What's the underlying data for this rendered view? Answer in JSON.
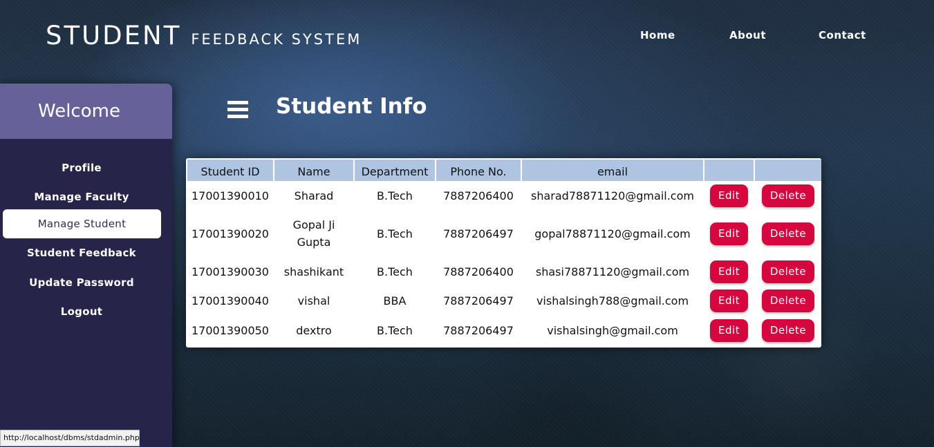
{
  "header": {
    "brand_main": "STUDENT",
    "brand_sub": "FEEDBACK SYSTEM",
    "nav": [
      "Home",
      "About",
      "Contact"
    ]
  },
  "sidebar": {
    "title": "Welcome",
    "items": [
      "Profile",
      "Manage Faculty",
      "Manage Student",
      "Student Feedback",
      "Update Password",
      "Logout"
    ],
    "active_item": "Manage Student"
  },
  "main": {
    "title": "Student Info",
    "menu_icon": "hamburger-icon"
  },
  "table": {
    "headers": [
      "Student ID",
      "Name",
      "Department",
      "Phone No.",
      "email",
      "",
      ""
    ],
    "edit_label": "Edit",
    "delete_label": "Delete",
    "rows": [
      {
        "id": "17001390010",
        "name": "Sharad",
        "department": "B.Tech",
        "phone": "7887206400",
        "email": "sharad78871120@gmail.com"
      },
      {
        "id": "17001390020",
        "name": "Gopal Ji Gupta",
        "department": "B.Tech",
        "phone": "7887206497",
        "email": "gopal78871120@gmail.com"
      },
      {
        "id": "17001390030",
        "name": "shashikant",
        "department": "B.Tech",
        "phone": "7887206400",
        "email": "shasi78871120@gmail.com"
      },
      {
        "id": "17001390040",
        "name": "vishal",
        "department": "BBA",
        "phone": "7887206497",
        "email": "vishalsingh788@gmail.com"
      },
      {
        "id": "17001390050",
        "name": "dextro",
        "department": "B.Tech",
        "phone": "7887206497",
        "email": "vishalsingh@gmail.com"
      }
    ]
  },
  "status_bar": {
    "url": "http://localhost/dbms/stdadmin.php"
  },
  "colors": {
    "sidebar_bg": "#27244a",
    "sidebar_header": "#67619a",
    "table_header": "#aec4e0",
    "button": "#d6073f"
  }
}
